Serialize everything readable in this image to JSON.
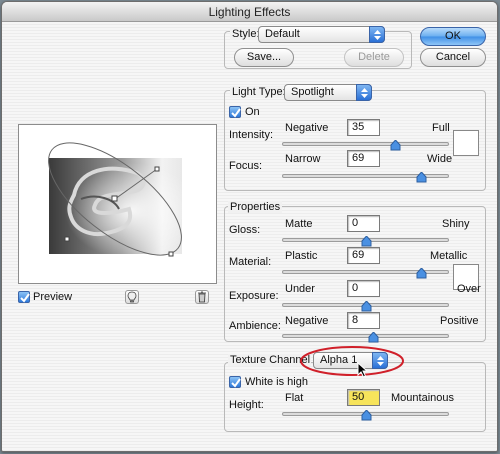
{
  "window": {
    "title": "Lighting Effects"
  },
  "style": {
    "label": "Style:",
    "value": "Default",
    "save_label": "Save...",
    "delete_label": "Delete"
  },
  "buttons": {
    "ok": "OK",
    "cancel": "Cancel"
  },
  "light_type": {
    "label": "Light Type:",
    "value": "Spotlight",
    "on_label": "On",
    "on_checked": true,
    "intensity": {
      "label": "Intensity:",
      "left": "Negative",
      "right": "Full",
      "value": "35",
      "level": 0.67
    },
    "focus": {
      "label": "Focus:",
      "left": "Narrow",
      "right": "Wide",
      "value": "69",
      "level": 0.83
    },
    "light_color": "#ffffff"
  },
  "properties": {
    "heading": "Properties",
    "gloss": {
      "label": "Gloss:",
      "left": "Matte",
      "right": "Shiny",
      "value": "0",
      "level": 0.5
    },
    "material": {
      "label": "Material:",
      "left": "Plastic",
      "right": "Metallic",
      "value": "69",
      "level": 0.83
    },
    "exposure": {
      "label": "Exposure:",
      "left": "Under",
      "right": "Over",
      "value": "0",
      "level": 0.5
    },
    "ambience": {
      "label": "Ambience:",
      "left": "Negative",
      "right": "Positive",
      "value": "8",
      "level": 0.54
    },
    "ambient_color": "#ffffff"
  },
  "texture": {
    "label": "Texture Channel:",
    "value": "Alpha 1",
    "white_is_high_label": "White is high",
    "white_is_high_checked": true,
    "height": {
      "label": "Height:",
      "left": "Flat",
      "right": "Mountainous",
      "value": "50",
      "level": 0.5
    }
  },
  "preview": {
    "label": "Preview",
    "checked": true
  },
  "colors": {
    "accent": "#3f8fe6",
    "highlight_circle": "#d0202a",
    "field_highlight": "#f7e45b"
  }
}
